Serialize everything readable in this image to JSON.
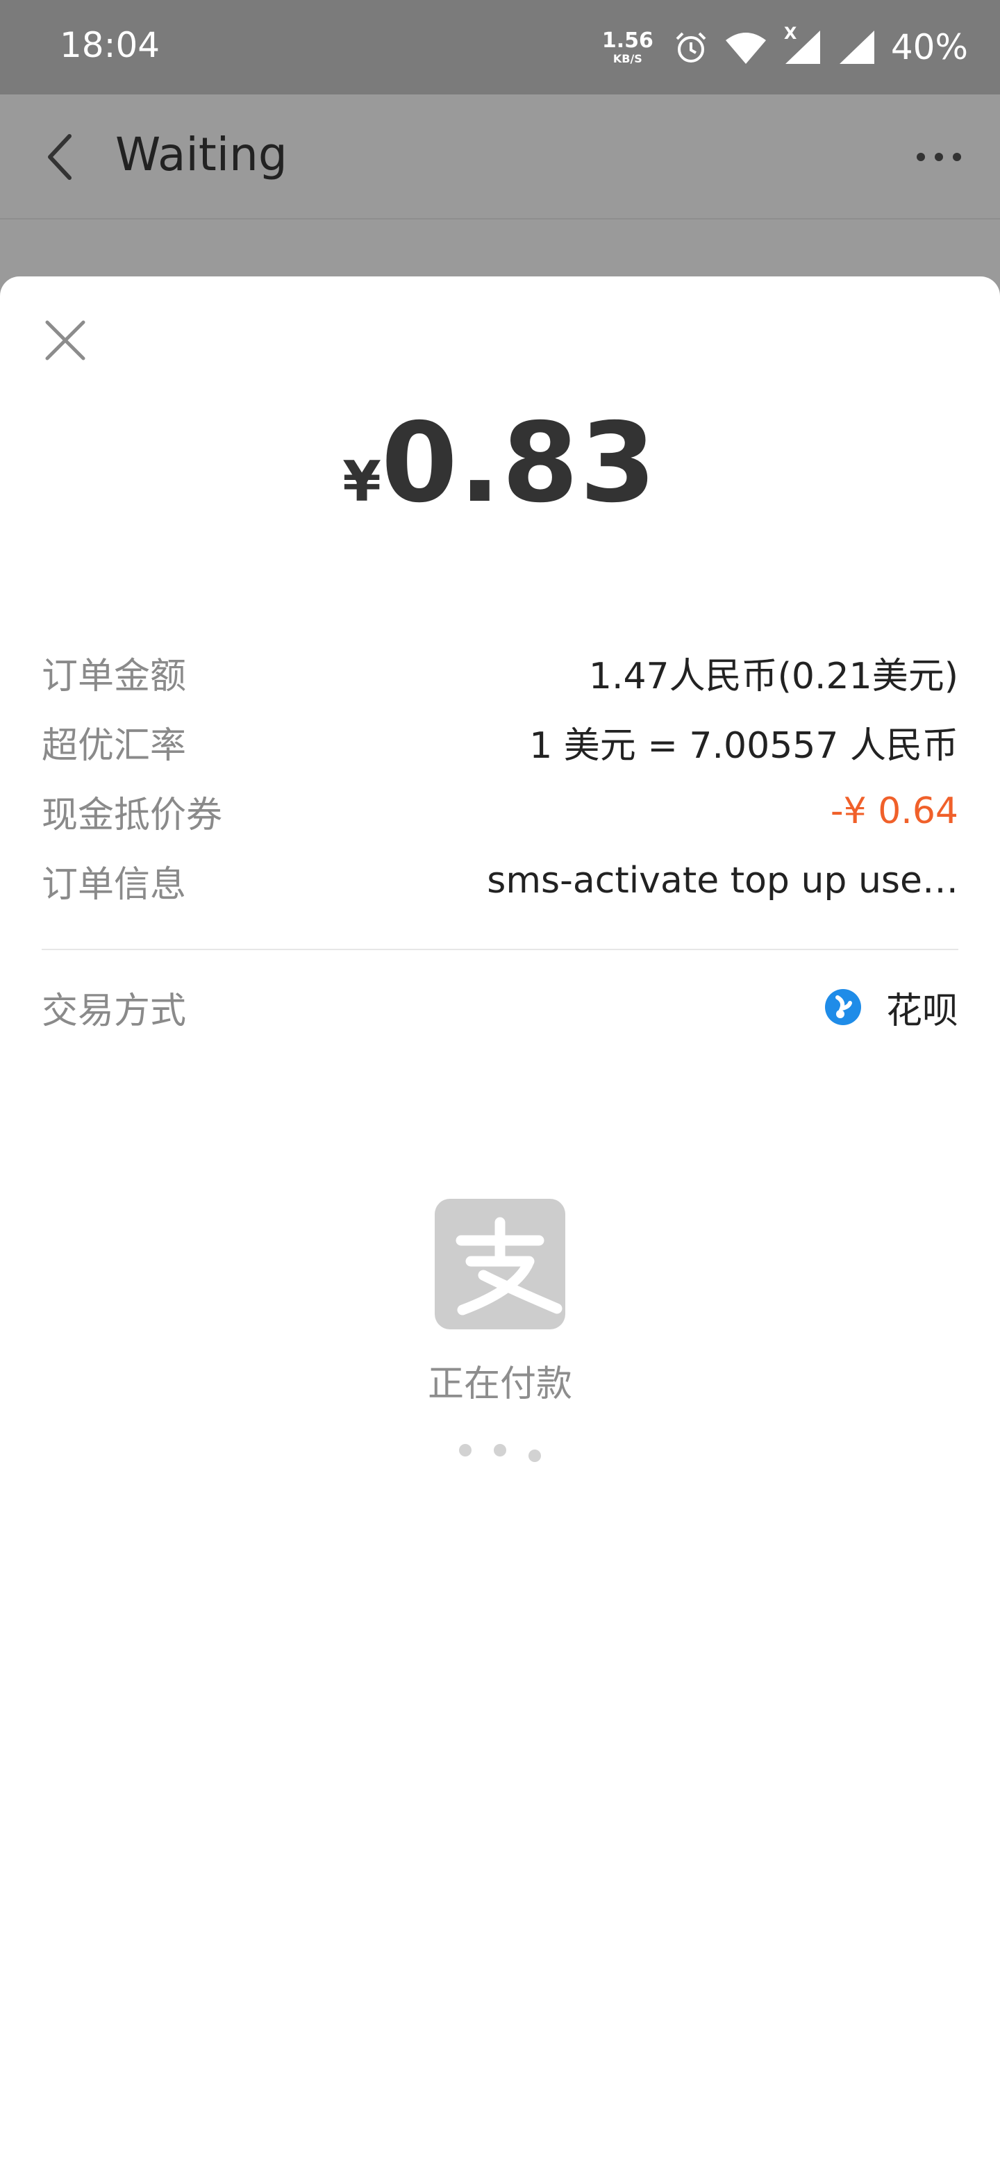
{
  "status_bar": {
    "time": "18:04",
    "net_speed_value": "1.56",
    "net_speed_unit": "KB/S",
    "signal_badge": "X",
    "battery": "40%",
    "icons": [
      "alarm-icon",
      "wifi-icon",
      "signal-icon",
      "signal-icon"
    ]
  },
  "app_bar": {
    "title": "Waiting",
    "back_icon": "chevron-left-icon",
    "more_icon": "more-icon"
  },
  "payment": {
    "currency_symbol": "¥",
    "amount": "0.83",
    "details": [
      {
        "label": "订单金额",
        "value": "1.47人民币(0.21美元)"
      },
      {
        "label": "超优汇率",
        "value": "1 美元 = 7.00557 人民币"
      },
      {
        "label": "现金抵价券",
        "value": "-¥ 0.64",
        "highlight": true
      },
      {
        "label": "订单信息",
        "value": "sms-activate top up use…"
      }
    ],
    "method_label": "交易方式",
    "method_value": "花呗",
    "status_text": "正在付款"
  },
  "colors": {
    "accent_orange": "#f0602a",
    "huabei_blue": "#1f8ce8",
    "overlay_gray": "#9a9a9a",
    "status_bar_gray": "#7b7b7b"
  }
}
